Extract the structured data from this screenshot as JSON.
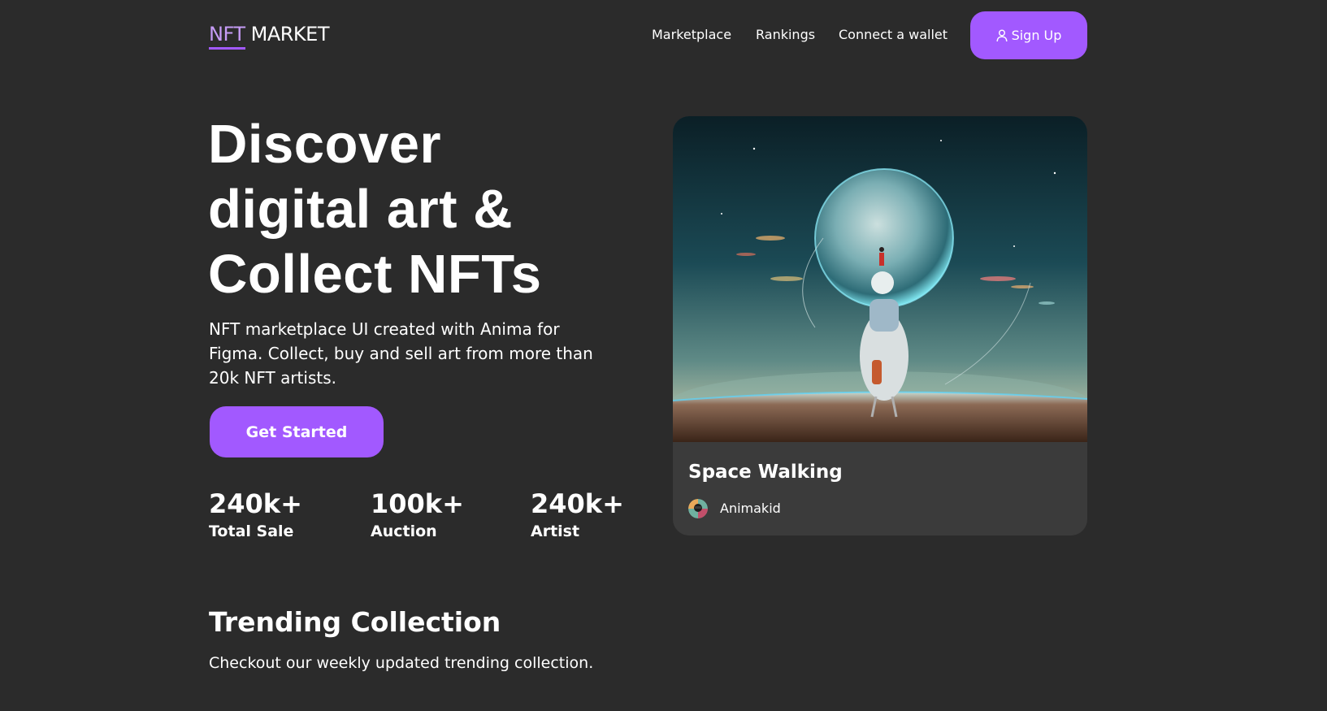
{
  "header": {
    "logo_nft": "NFT",
    "logo_market": " MARKET",
    "nav": {
      "marketplace": "Marketplace",
      "rankings": "Rankings",
      "connect_wallet": "Connect a wallet"
    },
    "signup_label": "Sign Up",
    "signup_icon": "user-icon"
  },
  "hero": {
    "title_line1": "Discover",
    "title_line2": "digital art &",
    "title_line3": "Collect NFTs",
    "description": "NFT marketplace UI created with Anima for Figma. Collect, buy and sell art from more than 20k NFT artists.",
    "cta_label": "Get Started",
    "stats": [
      {
        "value": "240k+",
        "label": "Total Sale"
      },
      {
        "value": "100k+",
        "label": "Auction"
      },
      {
        "value": "240k+",
        "label": "Artist"
      }
    ]
  },
  "featured_card": {
    "title": "Space Walking",
    "artist": "Animakid",
    "image": "astronaut-planet-artwork"
  },
  "trending": {
    "title": "Trending Collection",
    "subtitle": "Checkout our weekly updated trending collection."
  },
  "colors": {
    "background": "#2b2b2b",
    "accent": "#a259ff",
    "card_bg": "#3b3b3b",
    "text": "#ffffff"
  }
}
